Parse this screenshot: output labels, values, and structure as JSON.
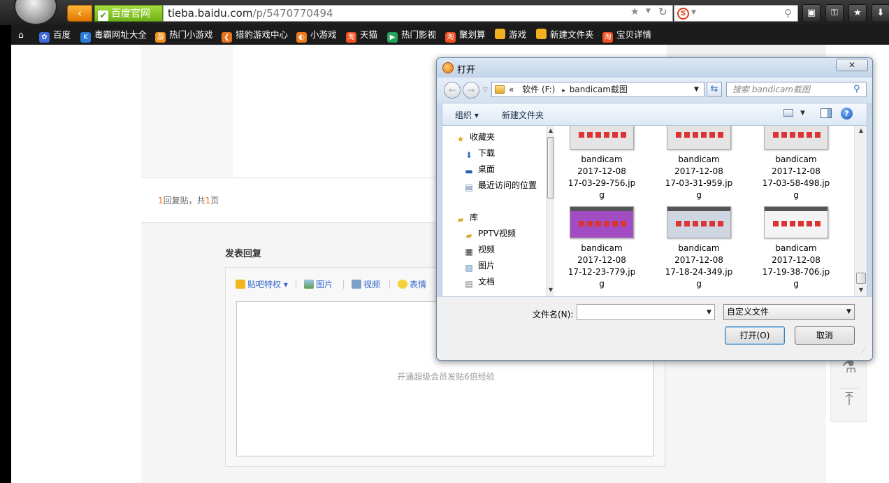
{
  "browser": {
    "back_arrow": "‹",
    "site_badge": "百度官网",
    "url_domain": "tieba.baidu.com",
    "url_path": "/p/5470770494",
    "icons": [
      "logo-icon",
      "back-icon",
      "check-icon",
      "star-icon",
      "refresh-icon",
      "search-engine-icon",
      "search-icon",
      "tab-icon",
      "lock-icon",
      "favorite-icon",
      "download-icon",
      "home-icon"
    ]
  },
  "bookmarks": [
    {
      "label": "百度",
      "color": "#3e6bd9",
      "glyph": "✿"
    },
    {
      "label": "毒霸网址大全",
      "color": "#2c7bd8",
      "glyph": "K"
    },
    {
      "label": "热门小游戏",
      "color": "#f08c18",
      "glyph": "游"
    },
    {
      "label": "猎豹游戏中心",
      "color": "#e8731d",
      "glyph": "❮"
    },
    {
      "label": "小游戏",
      "color": "#f07a1a",
      "glyph": "◐"
    },
    {
      "label": "天猫",
      "color": "#f05020",
      "glyph": "淘"
    },
    {
      "label": "热门影视",
      "color": "#26a05c",
      "glyph": "▶"
    },
    {
      "label": "聚划算",
      "color": "#f05020",
      "glyph": "淘"
    },
    {
      "label": "游戏",
      "color": "#f0b020",
      "glyph": ""
    },
    {
      "label": "新建文件夹",
      "color": "#f0b020",
      "glyph": ""
    },
    {
      "label": "宝贝详情",
      "color": "#f05020",
      "glyph": "淘"
    }
  ],
  "page": {
    "pager_count_1": "1",
    "pager_text_1": "回复贴，共",
    "pager_count_2": "1",
    "pager_text_2": "页",
    "reply_title": "发表回复",
    "toolbar": {
      "privilege": "贴吧特权",
      "image": "图片",
      "video": "视频",
      "emoji": "表情"
    },
    "editor_hint": "开通超级会员发贴6倍经验"
  },
  "dialog": {
    "title": "打开",
    "close": "✕",
    "path": {
      "prefix": "«",
      "drive": "软件 (F:)",
      "sep": "▸",
      "folder": "bandicam截图"
    },
    "search_placeholder": "搜索 bandicam截图",
    "organize": "组织 ▾",
    "new_folder": "新建文件夹",
    "help": "?",
    "tree": [
      {
        "label": "收藏夹",
        "icon": "★",
        "color": "#e8a317"
      },
      {
        "label": "下载",
        "icon": "⬇",
        "color": "#2f6fc0"
      },
      {
        "label": "桌面",
        "icon": "▬",
        "color": "#2a5fa8"
      },
      {
        "label": "最近访问的位置",
        "icon": "▤",
        "color": "#5a7ea8"
      },
      {
        "label": "库",
        "icon": "▰",
        "color": "#d9a83a"
      },
      {
        "label": "PPTV视频",
        "icon": "▰",
        "color": "#d9a83a"
      },
      {
        "label": "视频",
        "icon": "▦",
        "color": "#333"
      },
      {
        "label": "图片",
        "icon": "▨",
        "color": "#4f7fb7"
      },
      {
        "label": "文档",
        "icon": "▤",
        "color": "#777"
      }
    ],
    "files": [
      {
        "name": "bandicam",
        "date": "2017-12-08",
        "time": "17-03-29-756.jp",
        "ext": "g",
        "thumb": "#e4e4e4"
      },
      {
        "name": "bandicam",
        "date": "2017-12-08",
        "time": "17-03-31-959.jp",
        "ext": "g",
        "thumb": "#e4e4e4"
      },
      {
        "name": "bandicam",
        "date": "2017-12-08",
        "time": "17-03-58-498.jp",
        "ext": "g",
        "thumb": "#e4e4e4"
      },
      {
        "name": "bandicam",
        "date": "2017-12-08",
        "time": "17-12-23-779.jp",
        "ext": "g",
        "thumb": "#a24cc2"
      },
      {
        "name": "bandicam",
        "date": "2017-12-08",
        "time": "17-18-24-349.jp",
        "ext": "g",
        "thumb": "#cfd6e2"
      },
      {
        "name": "bandicam",
        "date": "2017-12-08",
        "time": "17-19-38-706.jp",
        "ext": "g",
        "thumb": "#f4f4f4"
      }
    ],
    "filename_label": "文件名(N):",
    "filename_value": "",
    "filetype": "自定义文件",
    "open_button": "打开(O)",
    "cancel_button": "取消"
  }
}
